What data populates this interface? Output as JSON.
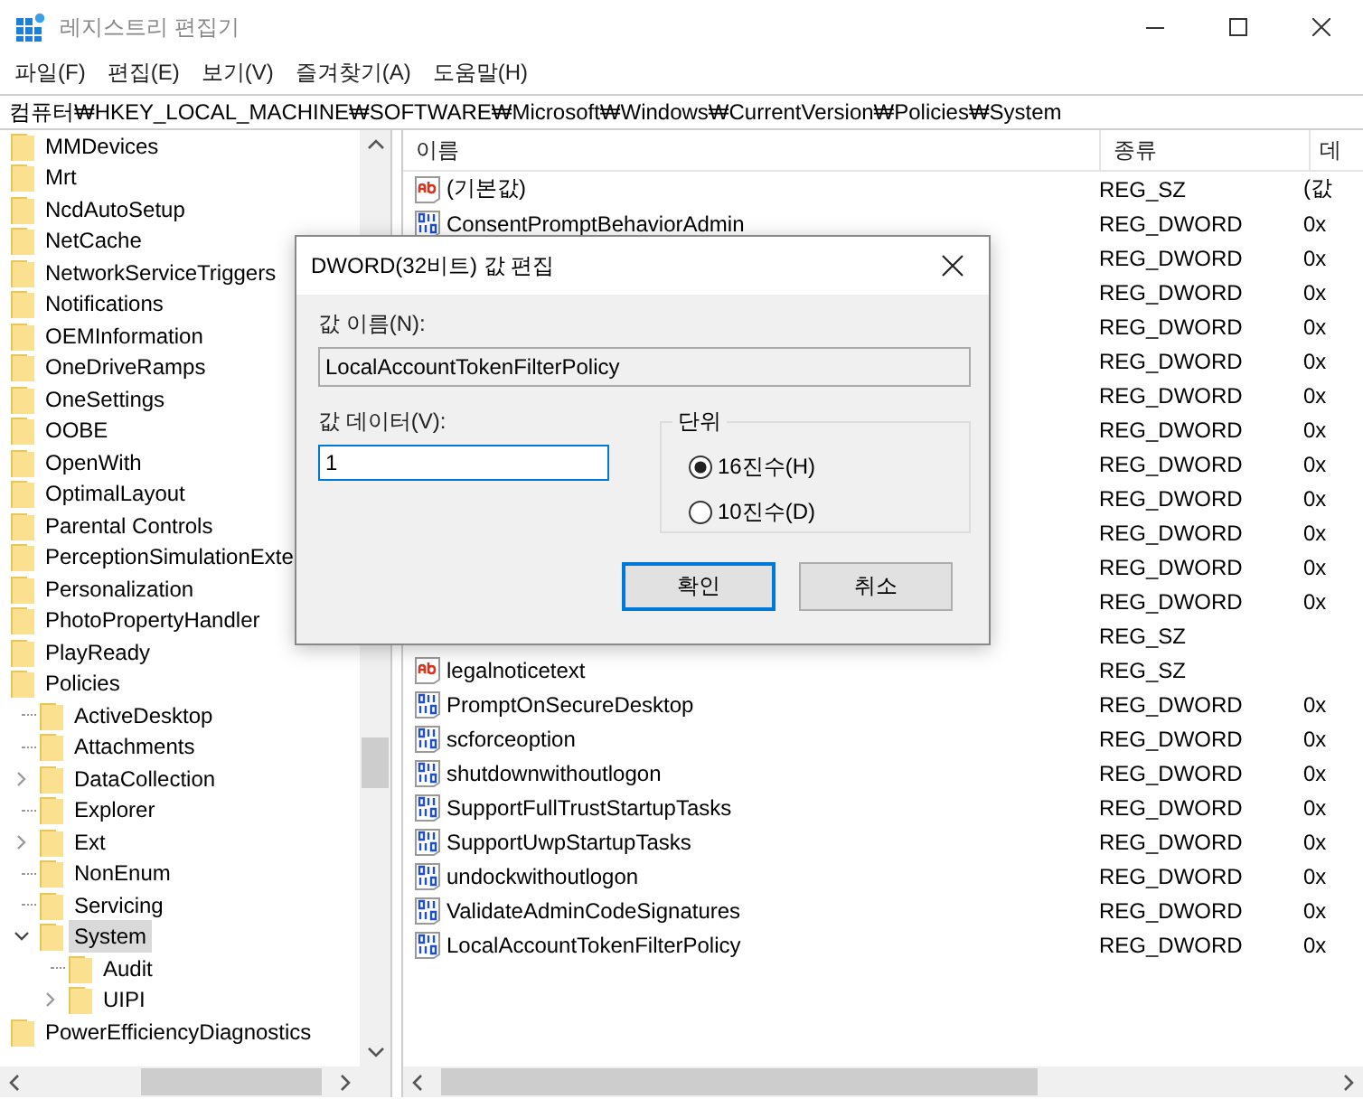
{
  "window": {
    "title": "레지스트리 편집기"
  },
  "menu": [
    {
      "label": "파일(F)"
    },
    {
      "label": "편집(E)"
    },
    {
      "label": "보기(V)"
    },
    {
      "label": "즐겨찾기(A)"
    },
    {
      "label": "도움말(H)"
    }
  ],
  "address": "컴퓨터₩HKEY_LOCAL_MACHINE₩SOFTWARE₩Microsoft₩Windows₩CurrentVersion₩Policies₩System",
  "tree": [
    {
      "label": "MMDevices",
      "selected": false
    },
    {
      "label": "Mrt",
      "selected": false
    },
    {
      "label": "NcdAutoSetup",
      "selected": false
    },
    {
      "label": "NetCache",
      "selected": false
    },
    {
      "label": "NetworkServiceTriggers",
      "selected": false
    },
    {
      "label": "Notifications",
      "selected": false
    },
    {
      "label": "OEMInformation",
      "selected": false
    },
    {
      "label": "OneDriveRamps",
      "selected": false
    },
    {
      "label": "OneSettings",
      "selected": false
    },
    {
      "label": "OOBE",
      "selected": false
    },
    {
      "label": "OpenWith",
      "selected": false
    },
    {
      "label": "OptimalLayout",
      "selected": false
    },
    {
      "label": "Parental Controls",
      "selected": false
    },
    {
      "label": "PerceptionSimulationExte",
      "selected": false
    },
    {
      "label": "Personalization",
      "selected": false
    },
    {
      "label": "PhotoPropertyHandler",
      "selected": false
    },
    {
      "label": "PlayReady",
      "selected": false
    },
    {
      "label": "Policies",
      "selected": false,
      "children": [
        {
          "label": "ActiveDesktop",
          "selected": false
        },
        {
          "label": "Attachments",
          "selected": false
        },
        {
          "label": "DataCollection",
          "selected": false,
          "expanded": false
        },
        {
          "label": "Explorer",
          "selected": false
        },
        {
          "label": "Ext",
          "selected": false,
          "expanded": false
        },
        {
          "label": "NonEnum",
          "selected": false
        },
        {
          "label": "Servicing",
          "selected": false
        },
        {
          "label": "System",
          "selected": true,
          "expanded": true,
          "children": [
            {
              "label": "Audit",
              "selected": false
            },
            {
              "label": "UIPI",
              "selected": false,
              "expanded": false
            }
          ]
        }
      ]
    },
    {
      "label": "PowerEfficiencyDiagnostics",
      "selected": false
    }
  ],
  "list": {
    "columns": [
      "이름",
      "종류",
      "데"
    ],
    "rows": [
      {
        "kind": "string",
        "name": "(기본값)",
        "type": "REG_SZ",
        "data": "(값"
      },
      {
        "kind": "dword",
        "name": "ConsentPromptBehaviorAdmin",
        "type": "REG_DWORD",
        "data": "0x"
      },
      {
        "type": "REG_DWORD",
        "data": "0x"
      },
      {
        "type": "REG_DWORD",
        "data": "0x"
      },
      {
        "type": "REG_DWORD",
        "data": "0x"
      },
      {
        "type": "REG_DWORD",
        "data": "0x"
      },
      {
        "type": "REG_DWORD",
        "data": "0x"
      },
      {
        "type": "REG_DWORD",
        "data": "0x"
      },
      {
        "type": "REG_DWORD",
        "data": "0x"
      },
      {
        "type": "REG_DWORD",
        "data": "0x"
      },
      {
        "type": "REG_DWORD",
        "data": "0x"
      },
      {
        "type": "REG_DWORD",
        "data": "0x"
      },
      {
        "type": "REG_DWORD",
        "data": "0x"
      },
      {
        "type": "REG_SZ"
      },
      {
        "kind": "string",
        "name": "legalnoticetext",
        "type": "REG_SZ"
      },
      {
        "kind": "dword",
        "name": "PromptOnSecureDesktop",
        "type": "REG_DWORD",
        "data": "0x"
      },
      {
        "kind": "dword",
        "name": "scforceoption",
        "type": "REG_DWORD",
        "data": "0x"
      },
      {
        "kind": "dword",
        "name": "shutdownwithoutlogon",
        "type": "REG_DWORD",
        "data": "0x"
      },
      {
        "kind": "dword",
        "name": "SupportFullTrustStartupTasks",
        "type": "REG_DWORD",
        "data": "0x"
      },
      {
        "kind": "dword",
        "name": "SupportUwpStartupTasks",
        "type": "REG_DWORD",
        "data": "0x"
      },
      {
        "kind": "dword",
        "name": "undockwithoutlogon",
        "type": "REG_DWORD",
        "data": "0x"
      },
      {
        "kind": "dword",
        "name": "ValidateAdminCodeSignatures",
        "type": "REG_DWORD",
        "data": "0x"
      },
      {
        "kind": "dword",
        "name": "LocalAccountTokenFilterPolicy",
        "type": "REG_DWORD",
        "data": "0x"
      }
    ]
  },
  "dialog": {
    "title": "DWORD(32비트) 값 편집",
    "name_label": "값 이름(N):",
    "name_value": "LocalAccountTokenFilterPolicy",
    "data_label": "값 데이터(V):",
    "data_value": "1",
    "base_label": "단위",
    "bases": [
      {
        "label": "16진수(H)",
        "selected": true
      },
      {
        "label": "10진수(D)",
        "selected": false
      }
    ],
    "buttons": [
      {
        "label": "확인",
        "default": true
      },
      {
        "label": "취소",
        "default": false
      }
    ]
  }
}
